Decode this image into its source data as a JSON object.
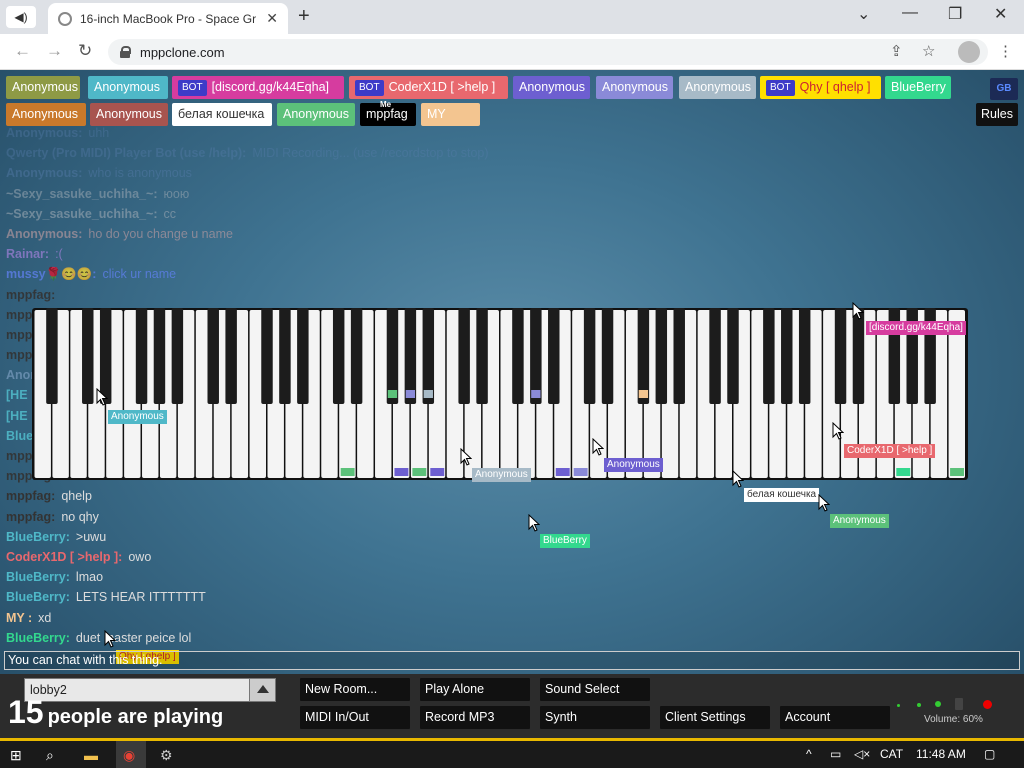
{
  "browser": {
    "tab_title": "16-inch MacBook Pro - Space Gr",
    "url": "mppclone.com"
  },
  "users": [
    {
      "name": "Anonymous",
      "color": "#8e9a45",
      "text": "#fff"
    },
    {
      "name": "Anonymous",
      "color": "#4fb8c8",
      "text": "#fff"
    },
    {
      "name": "[discord.gg/k44Eqha]",
      "color": "#d63c9f",
      "text": "#fff",
      "bot": "BOT"
    },
    {
      "name": "CoderX1D [ >help ]",
      "color": "#e8686e",
      "text": "#fff",
      "bot": "BOT"
    },
    {
      "name": "Anonymous",
      "color": "#6d5fd0",
      "text": "#fff"
    },
    {
      "name": "Anonymous",
      "color": "#8a8ad8",
      "text": "#fff"
    },
    {
      "name": "Anonymous",
      "color": "#a7bac7",
      "text": "#fff"
    },
    {
      "name": "Qhy [ qhelp ]",
      "color": "#ffe000",
      "text": "#c23",
      "bot": "BOT"
    },
    {
      "name": "BlueBerry",
      "color": "#33d88e",
      "text": "#fff"
    },
    {
      "name": "Anonymous",
      "color": "#c9792b",
      "text": "#fff"
    },
    {
      "name": "Anonymous",
      "color": "#a8544f",
      "text": "#fff"
    },
    {
      "name": "белая кошечка",
      "color": "#ffffff",
      "text": "#333"
    },
    {
      "name": "Anonymous",
      "color": "#5cc17a",
      "text": "#fff"
    },
    {
      "name": "mppfag",
      "color": "#000000",
      "text": "#fff",
      "me": "Me"
    },
    {
      "name": "MY",
      "color": "#f3c590",
      "text": "#fff"
    }
  ],
  "top_buttons": {
    "rules": "Rules",
    "gb": "GB"
  },
  "chat": [
    {
      "name": "Anonymous:",
      "msg": "uhh",
      "color": "#5a7fb0",
      "op": 0.35
    },
    {
      "name": "Qwerty (Pro MIDI) Player Bot (use /help):",
      "msg": "MIDI Recording... (use /recordstop to stop)",
      "color": "#5a7fb0",
      "op": 0.35
    },
    {
      "name": "Anonymous:",
      "msg": "who is anonymous",
      "color": "#5a7fb0",
      "op": 0.4
    },
    {
      "name": "~Sexy_sasuke_uchiha_~:",
      "msg": "юою",
      "color": "#9aa7b2",
      "op": 0.55
    },
    {
      "name": "~Sexy_sasuke_uchiha_~:",
      "msg": "cc",
      "color": "#9aa7b2",
      "op": 0.6
    },
    {
      "name": "Anonymous:",
      "msg": "ho do you change u name",
      "color": "#b89aa0",
      "op": 0.65
    },
    {
      "name": "Rainar:",
      "msg": ":(",
      "color": "#a080d8",
      "op": 0.7
    },
    {
      "name": "mussy🌹😊😊:",
      "msg": "click ur name",
      "color": "#6080f0",
      "op": 0.75
    },
    {
      "name": "mppfag:",
      "msg": "",
      "color": "#333",
      "op": 0.9
    },
    {
      "name": "mppfag:",
      "msg": "",
      "color": "#333",
      "op": 0.9
    },
    {
      "name": "mppfag:",
      "msg": "",
      "color": "#333",
      "op": 0.9
    },
    {
      "name": "mppfag:",
      "msg": "",
      "color": "#333",
      "op": 0.9
    },
    {
      "name": "Anonymous:",
      "msg": "",
      "color": "#6a8fb0",
      "op": 0.9
    },
    {
      "name": "[HE",
      "msg": "",
      "color": "#4fb8c8",
      "op": 0.9
    },
    {
      "name": "[HE",
      "msg": "",
      "color": "#4fb8c8",
      "op": 0.9
    },
    {
      "name": "BlueBerry:",
      "msg": "",
      "color": "#4fb8c8",
      "op": 0.9
    },
    {
      "name": "mppfag:",
      "msg": "",
      "color": "#333",
      "op": 0.9
    },
    {
      "name": "mppfag:",
      "msg": "",
      "color": "#333",
      "op": 0.9
    },
    {
      "name": "mppfag:",
      "msg": "qhelp",
      "color": "#333",
      "op": 1
    },
    {
      "name": "mppfag:",
      "msg": "no qhy",
      "color": "#333",
      "op": 1
    },
    {
      "name": "BlueBerry:",
      "msg": ">uwu",
      "color": "#4fb8c8",
      "op": 1
    },
    {
      "name": "CoderX1D [ >help ]:",
      "msg": "owo",
      "color": "#e8686e",
      "op": 1
    },
    {
      "name": "BlueBerry:",
      "msg": "lmao",
      "color": "#4fb8c8",
      "op": 1
    },
    {
      "name": "BlueBerry:",
      "msg": "LETS HEAR ITTTTTTT",
      "color": "#4fb8c8",
      "op": 1
    },
    {
      "name": "MY :",
      "msg": "xd",
      "color": "#f3c590",
      "op": 1
    },
    {
      "name": "BlueBerry:",
      "msg": "duet master peice lol",
      "color": "#33d88e",
      "op": 1
    }
  ],
  "cursors": [
    {
      "name": "Anonymous",
      "color": "#4fb8c8"
    },
    {
      "name": "[discord.gg/k44Eqha]",
      "color": "#d63c9f"
    },
    {
      "name": "Anonymous",
      "color": "#a7bac7"
    },
    {
      "name": "Anonymous",
      "color": "#6d5fd0"
    },
    {
      "name": "CoderX1D [ >help ]",
      "color": "#e8686e"
    },
    {
      "name": "белая кошечка",
      "color": "#ffffff"
    },
    {
      "name": "Anonymous",
      "color": "#5cc17a"
    },
    {
      "name": "BlueBerry",
      "color": "#33d88e"
    },
    {
      "name": "Qhy [ qhelp ]",
      "color": "#ffe000"
    }
  ],
  "chat_input": {
    "placeholder": "You can chat with this thing."
  },
  "bottom": {
    "room": "lobby2",
    "count": "15",
    "count_text": "people are playing",
    "buttons": [
      "New Room...",
      "Play Alone",
      "Sound Select",
      "MIDI In/Out",
      "Record MP3",
      "Synth",
      "Client Settings",
      "Account"
    ],
    "volume": "Volume: 60%"
  },
  "taskbar": {
    "lang": "CAT",
    "time": "11:48 AM"
  }
}
